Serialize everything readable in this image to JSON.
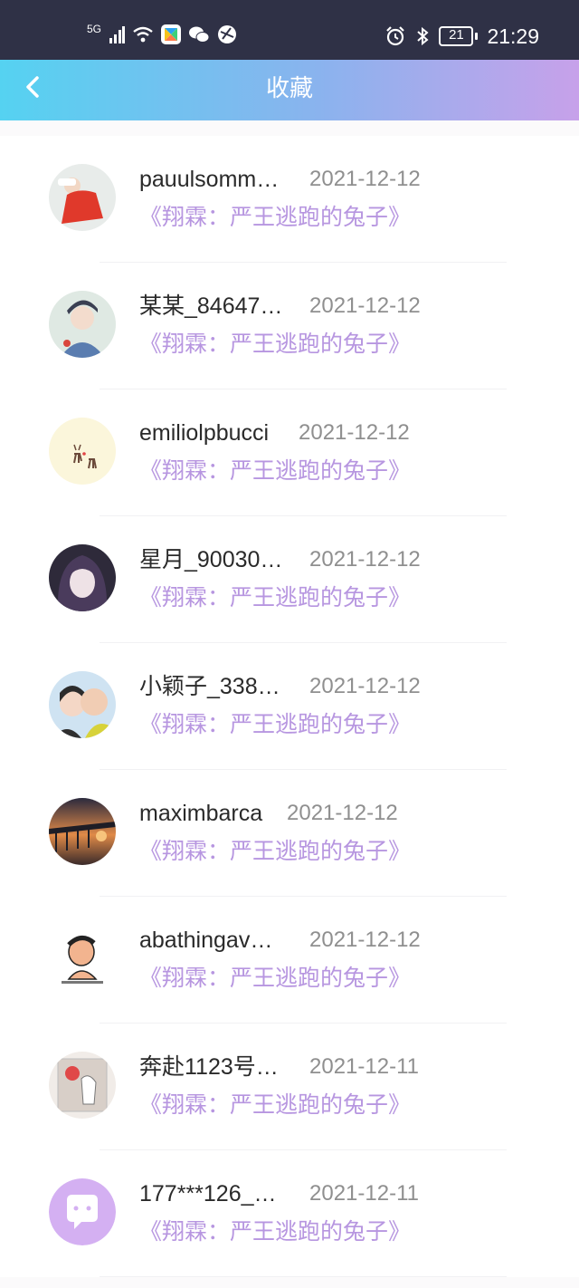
{
  "status_bar": {
    "network": "5G",
    "battery_level": "21",
    "time": "21:29",
    "icons": [
      "signal-icon",
      "wifi-icon",
      "app-icon",
      "wechat-icon",
      "browser-icon",
      "alarm-icon",
      "bluetooth-icon",
      "battery-icon"
    ]
  },
  "header": {
    "back_icon": "chevron-left-icon",
    "title": "收藏"
  },
  "items": [
    {
      "username": "pauulsomm…",
      "date": "2021-12-12",
      "title": "《翔霖：严王逃跑的兔子》",
      "avatar": "avatar-photo"
    },
    {
      "username": "某某_84647…",
      "date": "2021-12-12",
      "title": "《翔霖：严王逃跑的兔子》",
      "avatar": "avatar-photo"
    },
    {
      "username": "emiliolpbucci",
      "date": "2021-12-12",
      "title": "《翔霖：严王逃跑的兔子》",
      "avatar": "avatar-photo"
    },
    {
      "username": "星月_90030…",
      "date": "2021-12-12",
      "title": "《翔霖：严王逃跑的兔子》",
      "avatar": "avatar-photo"
    },
    {
      "username": "小颖子_338…",
      "date": "2021-12-12",
      "title": "《翔霖：严王逃跑的兔子》",
      "avatar": "avatar-photo"
    },
    {
      "username": "maximbarca",
      "date": "2021-12-12",
      "title": "《翔霖：严王逃跑的兔子》",
      "avatar": "avatar-photo"
    },
    {
      "username": "abathingav…",
      "date": "2021-12-12",
      "title": "《翔霖：严王逃跑的兔子》",
      "avatar": "avatar-photo"
    },
    {
      "username": "奔赴1123号…",
      "date": "2021-12-11",
      "title": "《翔霖：严王逃跑的兔子》",
      "avatar": "avatar-photo"
    },
    {
      "username": "177***126_…",
      "date": "2021-12-11",
      "title": "《翔霖：严王逃跑的兔子》",
      "avatar": "default-avatar-icon"
    }
  ],
  "colors": {
    "header_gradient_start": "#55d2f1",
    "header_gradient_end": "#c7a1ea",
    "title_accent": "#b796e0"
  }
}
